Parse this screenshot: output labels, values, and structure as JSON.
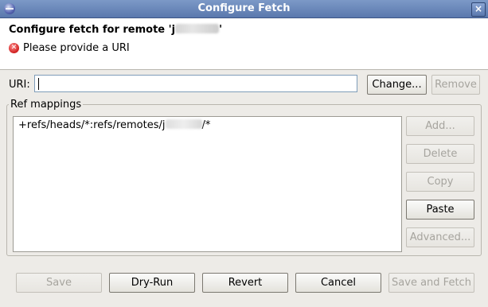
{
  "window": {
    "title": "Configure Fetch",
    "close_glyph": "×"
  },
  "header": {
    "heading_prefix": "Configure fetch for remote 'j",
    "heading_suffix": "'",
    "message": "Please provide a URI",
    "message_icon": "error-icon"
  },
  "uri": {
    "label": "URI:",
    "value": "",
    "change_label": "Change...",
    "remove_label": "Remove"
  },
  "ref_mappings": {
    "group_label": "Ref mappings",
    "items": [
      {
        "prefix": "+refs/heads/*:refs/remotes/j",
        "suffix": "/*"
      }
    ],
    "buttons": {
      "add": "Add...",
      "delete": "Delete",
      "copy": "Copy",
      "paste": "Paste",
      "advanced": "Advanced..."
    }
  },
  "footer": {
    "save": "Save",
    "dry_run": "Dry-Run",
    "revert": "Revert",
    "cancel": "Cancel",
    "save_and_fetch": "Save and Fetch"
  },
  "colors": {
    "titlebar": "#5a78ad",
    "error": "#d01f1f",
    "input_border": "#7f9db9"
  }
}
